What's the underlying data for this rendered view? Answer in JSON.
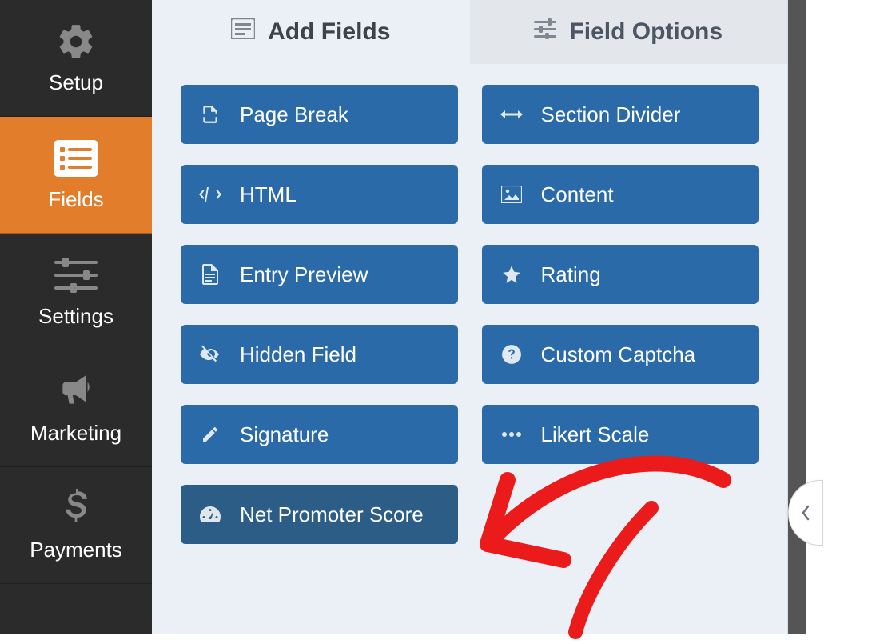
{
  "sidebar": {
    "items": [
      {
        "label": "Setup"
      },
      {
        "label": "Fields"
      },
      {
        "label": "Settings"
      },
      {
        "label": "Marketing"
      },
      {
        "label": "Payments"
      }
    ]
  },
  "tabs": {
    "add_fields": "Add Fields",
    "field_options": "Field Options"
  },
  "fields": {
    "page_break": "Page Break",
    "section_divider": "Section Divider",
    "html": "HTML",
    "content": "Content",
    "entry_preview": "Entry Preview",
    "rating": "Rating",
    "hidden_field": "Hidden Field",
    "custom_captcha": "Custom Captcha",
    "signature": "Signature",
    "likert_scale": "Likert Scale",
    "net_promoter_score": "Net Promoter Score"
  }
}
